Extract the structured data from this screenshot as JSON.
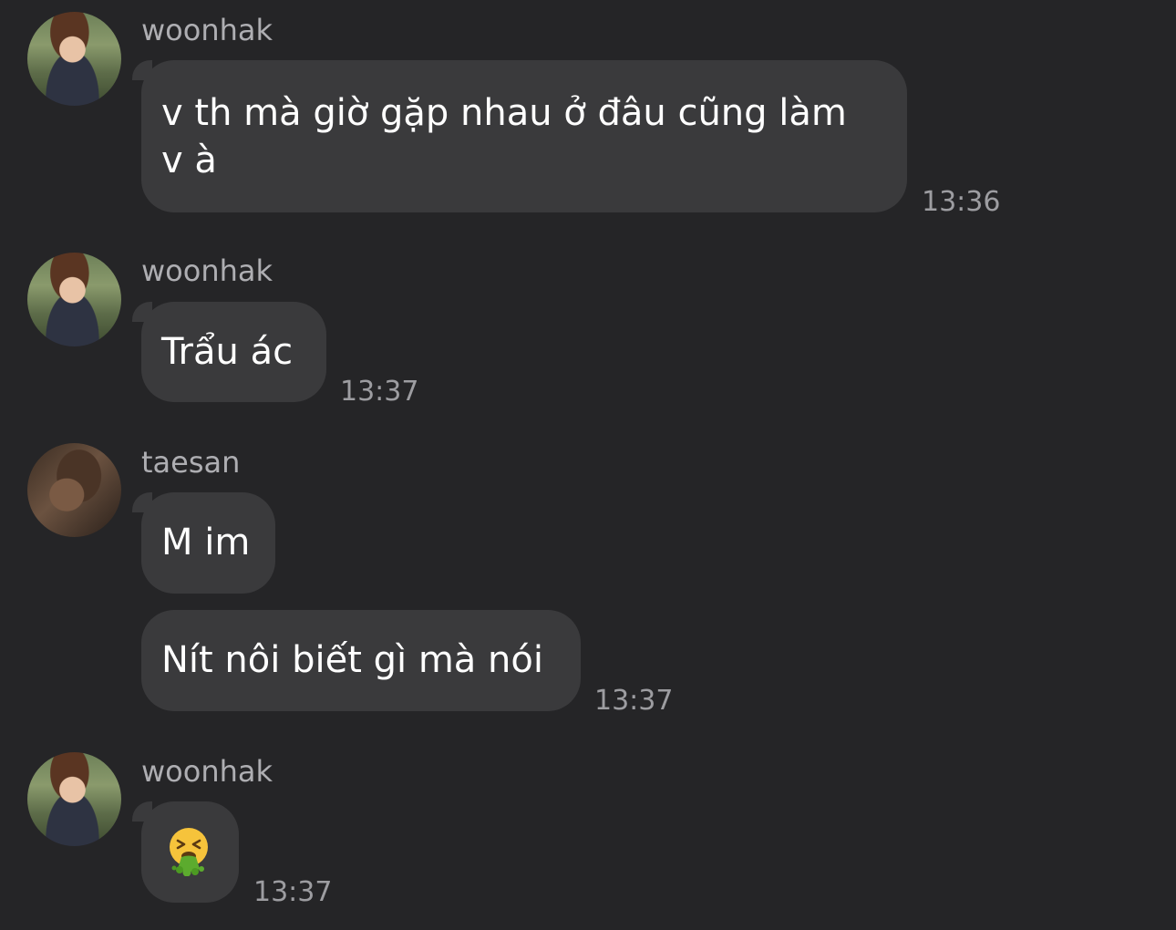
{
  "messages": [
    {
      "sender": "woonhak",
      "avatar_icon": "woonhak-avatar",
      "bubbles": [
        {
          "text": "v th mà giờ gặp nhau ở đâu cũng làm v à",
          "time": "13:36"
        }
      ]
    },
    {
      "sender": "woonhak",
      "avatar_icon": "woonhak-avatar",
      "bubbles": [
        {
          "text": "Trẩu ác",
          "time": "13:37"
        }
      ]
    },
    {
      "sender": "taesan",
      "avatar_icon": "taesan-avatar",
      "bubbles": [
        {
          "text": "M im",
          "time": ""
        },
        {
          "text": "Nít nôi biết gì mà nói",
          "time": "13:37"
        }
      ]
    },
    {
      "sender": "woonhak",
      "avatar_icon": "woonhak-avatar",
      "bubbles": [
        {
          "emoji": "vomiting-face-icon",
          "time": "13:37"
        }
      ]
    }
  ],
  "colors": {
    "background": "#252527",
    "bubble": "#3a3a3c",
    "message_text": "#ffffff",
    "meta_text": "#9d9da1"
  }
}
